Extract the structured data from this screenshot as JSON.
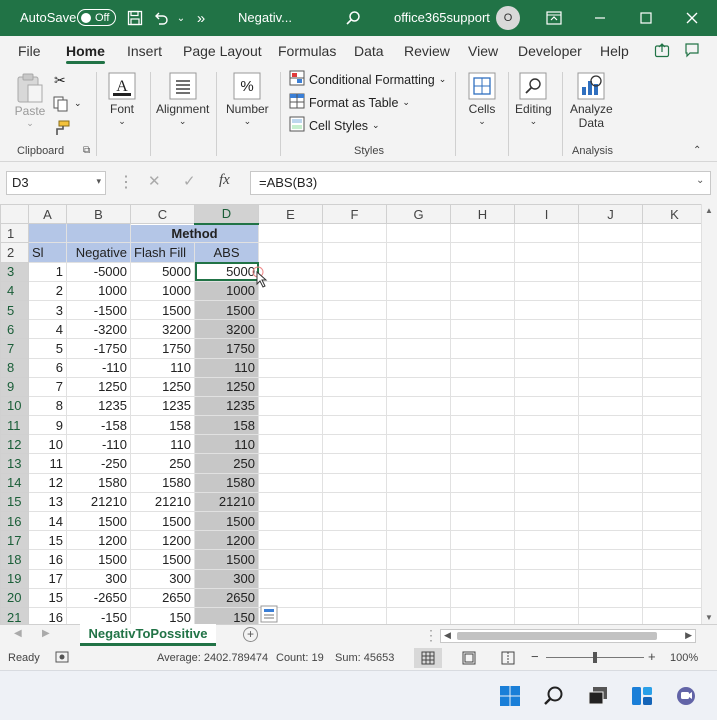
{
  "titlebar": {
    "autosave_label": "AutoSave",
    "autosave_state": "Off",
    "filename": "Negativ...",
    "account": "office365support",
    "avatar_initial": "O"
  },
  "menu": {
    "tabs": [
      "File",
      "Home",
      "Insert",
      "Page Layout",
      "Formulas",
      "Data",
      "Review",
      "View",
      "Developer",
      "Help"
    ],
    "active": "Home"
  },
  "ribbon": {
    "clipboard": {
      "paste": "Paste",
      "label": "Clipboard"
    },
    "font": {
      "label": "Font"
    },
    "alignment": {
      "label": "Alignment"
    },
    "number": {
      "label": "Number"
    },
    "styles": {
      "conditional_formatting": "Conditional Formatting",
      "format_as_table": "Format as Table",
      "cell_styles": "Cell Styles",
      "label": "Styles"
    },
    "cells": {
      "label": "Cells"
    },
    "editing": {
      "label": "Editing"
    },
    "analysis": {
      "analyze_line1": "Analyze",
      "analyze_line2": "Data",
      "label": "Analysis"
    }
  },
  "formula_bar": {
    "name_box": "D3",
    "fx": "fx",
    "formula": "=ABS(B3)"
  },
  "columns": [
    "A",
    "B",
    "C",
    "D",
    "E",
    "F",
    "G",
    "H",
    "I",
    "J",
    "K"
  ],
  "header_rows": {
    "row1": {
      "C": "Method"
    },
    "row2": {
      "A": "Sl",
      "B": "Negative",
      "C": "Flash Fill",
      "D": "ABS"
    }
  },
  "data_rows": [
    {
      "row": "3",
      "sl": "1",
      "neg": "-5000",
      "ff": "5000",
      "abs": "5000"
    },
    {
      "row": "4",
      "sl": "2",
      "neg": "1000",
      "ff": "1000",
      "abs": "1000"
    },
    {
      "row": "5",
      "sl": "3",
      "neg": "-1500",
      "ff": "1500",
      "abs": "1500"
    },
    {
      "row": "6",
      "sl": "4",
      "neg": "-3200",
      "ff": "3200",
      "abs": "3200"
    },
    {
      "row": "7",
      "sl": "5",
      "neg": "-1750",
      "ff": "1750",
      "abs": "1750"
    },
    {
      "row": "8",
      "sl": "6",
      "neg": "-110",
      "ff": "110",
      "abs": "110"
    },
    {
      "row": "9",
      "sl": "7",
      "neg": "1250",
      "ff": "1250",
      "abs": "1250"
    },
    {
      "row": "10",
      "sl": "8",
      "neg": "1235",
      "ff": "1235",
      "abs": "1235"
    },
    {
      "row": "11",
      "sl": "9",
      "neg": "-158",
      "ff": "158",
      "abs": "158"
    },
    {
      "row": "12",
      "sl": "10",
      "neg": "-110",
      "ff": "110",
      "abs": "110"
    },
    {
      "row": "13",
      "sl": "11",
      "neg": "-250",
      "ff": "250",
      "abs": "250"
    },
    {
      "row": "14",
      "sl": "12",
      "neg": "1580",
      "ff": "1580",
      "abs": "1580"
    },
    {
      "row": "15",
      "sl": "13",
      "neg": "21210",
      "ff": "21210",
      "abs": "21210"
    },
    {
      "row": "16",
      "sl": "14",
      "neg": "1500",
      "ff": "1500",
      "abs": "1500"
    },
    {
      "row": "17",
      "sl": "15",
      "neg": "1200",
      "ff": "1200",
      "abs": "1200"
    },
    {
      "row": "18",
      "sl": "16",
      "neg": "1500",
      "ff": "1500",
      "abs": "1500"
    },
    {
      "row": "19",
      "sl": "17",
      "neg": "300",
      "ff": "300",
      "abs": "300"
    },
    {
      "row": "20",
      "sl": "15",
      "neg": "-2650",
      "ff": "2650",
      "abs": "2650"
    },
    {
      "row": "21",
      "sl": "16",
      "neg": "-150",
      "ff": "150",
      "abs": "150"
    }
  ],
  "sheet_tab": "NegativToPossitive",
  "status": {
    "ready": "Ready",
    "average": "Average: 2402.789474",
    "count": "Count: 19",
    "sum": "Sum: 45653",
    "zoom": "100%"
  },
  "colors": {
    "excel_green": "#217346",
    "header_blue": "#b4c6e7",
    "selection_gray": "#c7c7c7"
  }
}
